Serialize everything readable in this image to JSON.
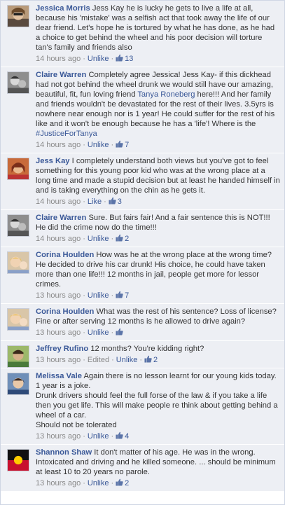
{
  "comments": [
    {
      "author": "Jessica Morris",
      "text": "Jess Kay he is lucky he gets to live a life at all, because his 'mistake' was a selfish act that took away the life of our dear friend. Let's hope he is tortured by what he has done, as he had a choice to get behind the wheel and his poor decision will torture tan's family and friends also",
      "time": "14 hours ago",
      "action": "Unlike",
      "likes": "13",
      "avatar": "woman-sunglasses"
    },
    {
      "author": "Claire Warren",
      "text_parts": [
        "Completely agree Jessica! Jess Kay- if this dickhead had not got behind the wheel drunk we would still have our amazing, beautiful, fit, fun loving friend ",
        "Tanya Roneberg",
        " here!!! And her family and friends wouldn't be devastated for the rest of their lives. 3.5yrs is nowhere near enough nor is 1 year! He could suffer for the rest of his like and it won't be enough because he has a 'life'! Where is the ",
        "#JusticeForTanya"
      ],
      "time": "14 hours ago",
      "action": "Unlike",
      "likes": "7",
      "avatar": "woman-child"
    },
    {
      "author": "Jess Kay",
      "text": "I completely understand both views but you've got to feel something for this young poor kid who was at the wrong place at a long time and made a stupid decision but at least he handed himself in and is taking everything on the chin as he gets it.",
      "time": "14 hours ago",
      "action": "Like",
      "likes": "3",
      "avatar": "woman-red"
    },
    {
      "author": "Claire Warren",
      "text": "Sure. But fairs fair! And a fair sentence this is NOT!!! He did the crime now do the time!!!",
      "time": "14 hours ago",
      "action": "Unlike",
      "likes": "2",
      "avatar": "woman-child"
    },
    {
      "author": "Corina Houlden",
      "text": "How was he at the wrong place at the wrong time? He decided to drive his car drunk! His choice, he could have taken more than one life!!! 12 months in jail, people get more for lessor crimes.",
      "time": "13 hours ago",
      "action": "Unlike",
      "likes": "7",
      "avatar": "woman-blonde"
    },
    {
      "author": "Corina Houlden",
      "text": "What was the rest of his sentence? Loss of license? Fine or after serving 12 months is he allowed to drive again?",
      "time": "13 hours ago",
      "action": "Unlike",
      "likes": "",
      "avatar": "woman-blonde"
    },
    {
      "author": "Jeffrey Rufino",
      "text": "12 months? You're kidding right?",
      "time": "13 hours ago",
      "edited": "Edited",
      "action": "Unlike",
      "likes": "2",
      "avatar": "man-green"
    },
    {
      "author": "Melissa Vale",
      "text": "Again there is no lesson learnt for our young kids today.\n1 year is a joke.\nDrunk drivers should feel the full forse of the law & if you take a life then you get life. This will make people re think about getting behind a wheel of a car.\nShould not be tolerated",
      "time": "13 hours ago",
      "action": "Unlike",
      "likes": "4",
      "avatar": "woman-blue"
    },
    {
      "author": "Shannon Shaw",
      "text": "It don't matter of his age. He was in the wrong. Intoxicated and driving and he killed someone. ... should be minimum at least 10 to 20 years no parole.",
      "time": "13 hours ago",
      "action": "Unlike",
      "likes": "2",
      "avatar": "flag"
    }
  ],
  "colors": {
    "author": "#3b5998",
    "background": "#edeff4",
    "meta": "#8a8a8a"
  }
}
